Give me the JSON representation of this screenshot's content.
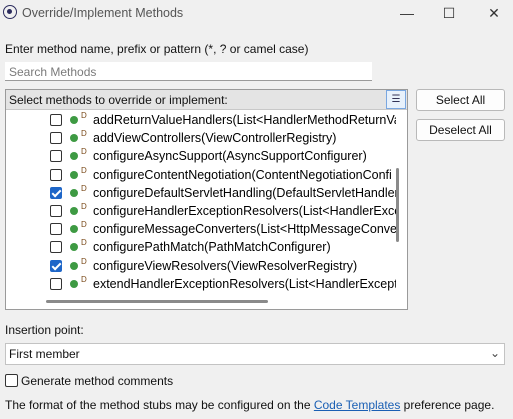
{
  "window": {
    "title": "Override/Implement Methods",
    "minimize_glyph": "—",
    "maximize_glyph": "☐",
    "close_glyph": "✕"
  },
  "search": {
    "label": "Enter method name, prefix or pattern (*, ? or camel case)",
    "placeholder": "Search Methods",
    "value": ""
  },
  "methods_panel": {
    "header": "Select methods to override or implement:",
    "marker": "D",
    "items": [
      {
        "name": "addReturnValueHandlers(List<HandlerMethodReturnVal",
        "checked": false
      },
      {
        "name": "addViewControllers(ViewControllerRegistry)",
        "checked": false
      },
      {
        "name": "configureAsyncSupport(AsyncSupportConfigurer)",
        "checked": false
      },
      {
        "name": "configureContentNegotiation(ContentNegotiationConfi",
        "checked": false
      },
      {
        "name": "configureDefaultServletHandling(DefaultServletHandler",
        "checked": true
      },
      {
        "name": "configureHandlerExceptionResolvers(List<HandlerExcep",
        "checked": false
      },
      {
        "name": "configureMessageConverters(List<HttpMessageConvert",
        "checked": false
      },
      {
        "name": "configurePathMatch(PathMatchConfigurer)",
        "checked": false
      },
      {
        "name": "configureViewResolvers(ViewResolverRegistry)",
        "checked": true
      },
      {
        "name": "extendHandlerExceptionResolvers(List<HandlerExceptio",
        "checked": false
      }
    ]
  },
  "buttons": {
    "select_all": "Select All",
    "deselect_all": "Deselect All"
  },
  "insertion": {
    "label": "Insertion point:",
    "selected": "First member"
  },
  "generate_comments": {
    "label": "Generate method comments",
    "checked": false
  },
  "footer": {
    "prefix": "The format of the method stubs may be configured on the ",
    "link": "Code Templates",
    "suffix": " preference page."
  }
}
